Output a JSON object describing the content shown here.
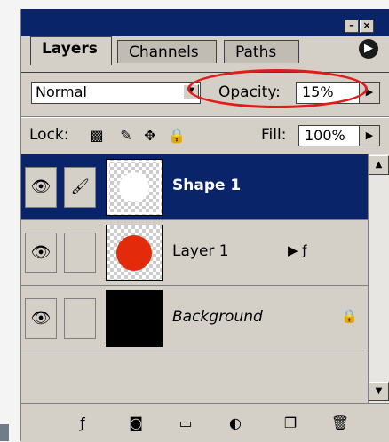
{
  "tabs": [
    {
      "label": "Layers"
    },
    {
      "label": "Channels"
    },
    {
      "label": "Paths"
    }
  ],
  "blend_mode": {
    "value": "Normal"
  },
  "opacity": {
    "label": "Opacity:",
    "value": "15%"
  },
  "lock": {
    "label": "Lock:"
  },
  "fill": {
    "label": "Fill:",
    "value": "100%"
  },
  "layers": [
    {
      "name": "Shape 1",
      "selected": true
    },
    {
      "name": "Layer 1",
      "selected": false
    },
    {
      "name": "Background",
      "selected": false
    }
  ],
  "colors": {
    "accent": "#0a246a",
    "highlight_ring": "#e21a1a",
    "layer_dot": "#e32a0a"
  },
  "icons": {
    "title_minimize": "minimize-icon",
    "title_close": "close-icon",
    "panel_menu": "panel-menu-icon",
    "lock_transparency": "lock-transparency-icon",
    "lock_paint": "lock-paint-icon",
    "lock_move": "lock-move-icon",
    "lock_all": "lock-all-icon",
    "bottom": [
      "add-style-icon",
      "add-mask-icon",
      "new-group-icon",
      "adjustment-layer-icon",
      "new-layer-icon",
      "delete-layer-icon"
    ]
  }
}
